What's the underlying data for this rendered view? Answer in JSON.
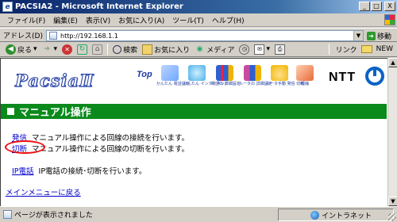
{
  "window": {
    "title": "PACSIA2 - Microsoft Internet Explorer",
    "controls": {
      "minimize": "_",
      "maximize": "□",
      "close": "X"
    }
  },
  "menubar": {
    "items": [
      "ファイル(F)",
      "編集(E)",
      "表示(V)",
      "お気に入り(A)",
      "ツール(T)",
      "ヘルプ(H)"
    ]
  },
  "addressbar": {
    "label": "アドレス(D)",
    "url": "http://192.168.1.1",
    "go_label": "移動"
  },
  "toolbar": {
    "back_label": "戻る",
    "search_label": "検索",
    "favorites_label": "お気に入り",
    "media_label": "メディア",
    "links_label": "リンク",
    "new_label": "NEW"
  },
  "page": {
    "logo_text": "PacsiaⅡ",
    "top_link": "Top",
    "nav_icons": [
      {
        "caption": "かんたん 電話設定",
        "color": "#6fa8ff"
      },
      {
        "caption": "かんたん インターネット",
        "color": "#4bb0e8"
      },
      {
        "caption": "電話の 詳細設定",
        "color": "#2f5fd0"
      },
      {
        "caption": "ルータの 詳細設定",
        "color": "#c84b9e"
      },
      {
        "caption": "ルータ手動 発信 切断",
        "color": "#f0b400"
      },
      {
        "caption": "短縮",
        "color": "#e86a3a"
      }
    ],
    "brand": "NTT",
    "heading": "マニュアル操作",
    "rows": [
      {
        "link": "発信",
        "desc": "マニュアル操作による回線の接続を行います。"
      },
      {
        "link": "切断",
        "desc": "マニュアル操作による回線の切断を行います。"
      },
      {
        "link": "IP電話",
        "desc": "IP電話の接続･切断を行います。"
      }
    ],
    "back_link": "メインメニューに戻る"
  },
  "statusbar": {
    "text": "ページが表示されました",
    "zone": "イントラネット"
  },
  "colors": {
    "heading_bg": "#0a8a1a",
    "link": "#0000cc",
    "highlight_circle": "#e11111"
  }
}
